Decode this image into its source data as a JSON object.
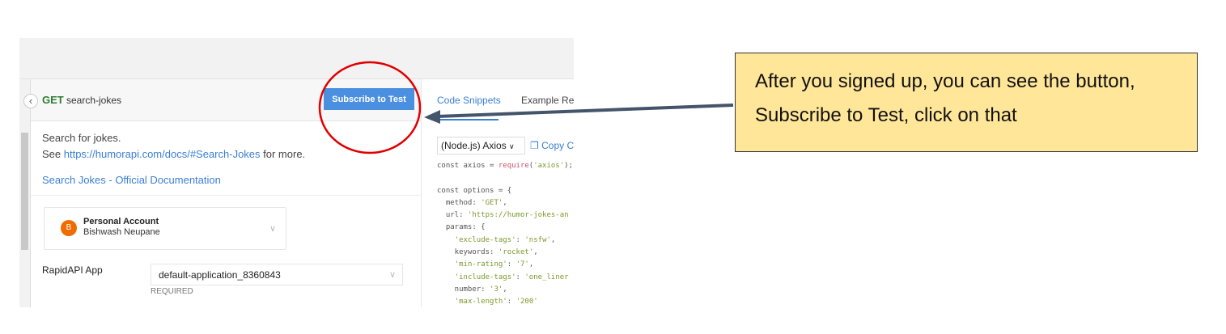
{
  "endpoint": {
    "method": "GET",
    "name": "search-jokes",
    "subscribe_label": "Subscribe to Test"
  },
  "description": {
    "line1": "Search for jokes.",
    "see": "See ",
    "link": "https://humorapi.com/docs/#Search-Jokes",
    "after": " for more.",
    "doc_link": "Search Jokes - Official Documentation"
  },
  "account": {
    "avatar": "B",
    "type": "Personal Account",
    "user": "Bishwash Neupane"
  },
  "app": {
    "label": "RapidAPI App",
    "value": "default-application_8360843",
    "required": "REQUIRED"
  },
  "right": {
    "tabs": [
      "Code Snippets",
      "Example Res"
    ],
    "language": "(Node.js) Axios",
    "copy": "Copy C",
    "code": [
      "const axios = require('axios');",
      "",
      "const options = {",
      "  method: 'GET',",
      "  url: 'https://humor-jokes-an",
      "  params: {",
      "    'exclude-tags': 'nsfw',",
      "    keywords: 'rocket',",
      "    'min-rating': '7',",
      "    'include-tags': 'one_liner",
      "    number: '3',",
      "    'max-length': '200'"
    ]
  },
  "callout": {
    "text": "After you signed up, you can see the button, Subscribe to Test, click on that",
    "arrow_color": "#44546a",
    "circle_color": "#e00000"
  }
}
